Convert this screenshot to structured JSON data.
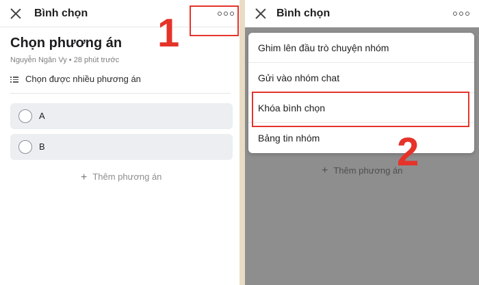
{
  "left": {
    "header_title": "Bình chọn",
    "poll_title": "Chọn phương án",
    "poll_meta": "Nguyễn Ngân Vy • 28 phút trước",
    "multi_choice_label": "Chọn được nhiều phương án",
    "options": [
      {
        "label": "A"
      },
      {
        "label": "B"
      }
    ],
    "add_option_label": "Thêm phương án",
    "step_label": "1"
  },
  "right": {
    "header_title": "Bình chọn",
    "menu": [
      {
        "label": "Ghim lên đầu trò chuyện nhóm"
      },
      {
        "label": "Gửi vào nhóm chat"
      },
      {
        "label": "Khóa bình chọn"
      },
      {
        "label": "Bảng tin nhóm"
      }
    ],
    "add_option_label": "Thêm phương án",
    "step_label": "2"
  },
  "colors": {
    "highlight": "#e5332a",
    "overlay": "#8e8e8e",
    "option_bg": "#eceef1"
  },
  "icons": [
    "close-icon",
    "more-icon",
    "list-icon",
    "radio-icon",
    "plus-icon"
  ]
}
